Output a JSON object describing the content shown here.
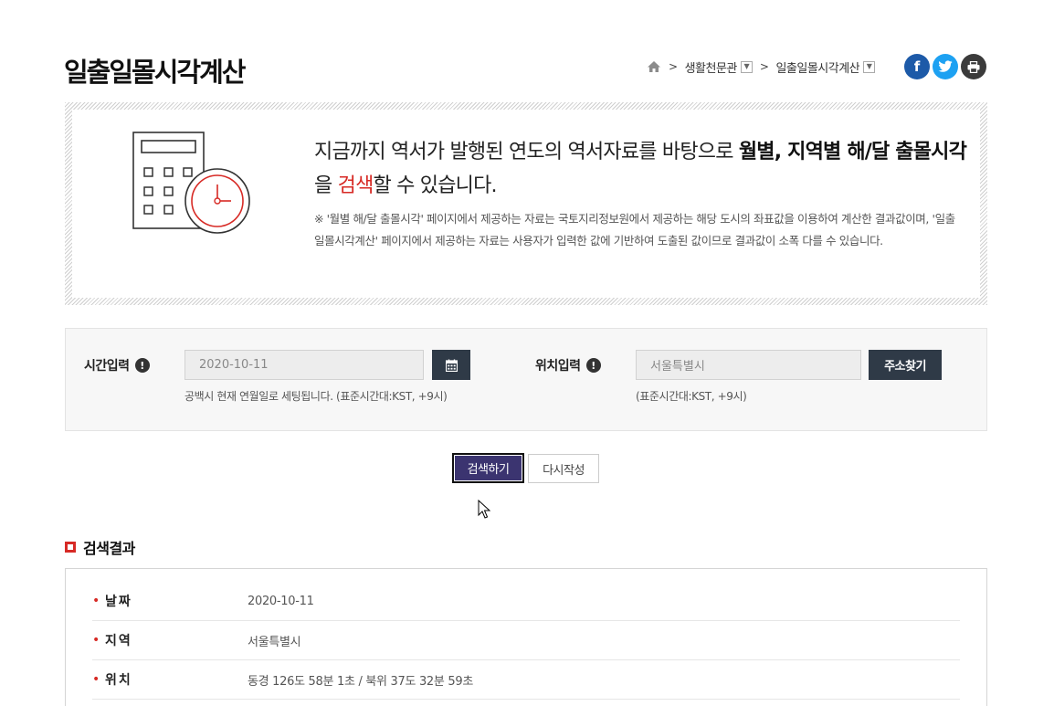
{
  "page": {
    "title": "일출일몰시각계산"
  },
  "breadcrumb": {
    "items": [
      {
        "label": "생활천문관"
      },
      {
        "label": "일출일몰시각계산"
      }
    ]
  },
  "social": {
    "facebook_glyph": "f",
    "twitter_glyph": "t"
  },
  "intro": {
    "lead_1": "지금까지 역서가 발행된 연도의 역서자료를 바탕으로 ",
    "lead_bold_1": "월별, 지역별 해/달 출몰시각",
    "lead_2": "을 ",
    "lead_red": "검색",
    "lead_3": "할 수 있습니다.",
    "note": "※ '월별 해/달 출몰시각' 페이지에서 제공하는 자료는 국토지리정보원에서 제공하는 해당 도시의 좌표값을 이용하여 계산한 결과값이며, '일출일몰시각계산' 페이지에서 제공하는 자료는 사용자가 입력한 값에 기반하여 도출된 값이므로 결과값이 소폭 다를 수 있습니다."
  },
  "form": {
    "time_label": "시간입력",
    "time_value": "2020-10-11",
    "time_hint": "공백시 현재 연월일로 세팅됩니다. (표준시간대:KST, +9시)",
    "location_label": "위치입력",
    "location_value": "서울특별시",
    "location_hint": "(표준시간대:KST, +9시)",
    "address_button": "주소찾기",
    "info_glyph": "!"
  },
  "actions": {
    "search": "검색하기",
    "reset": "다시작성"
  },
  "result": {
    "title": "검색결과",
    "bullet": "•",
    "rows": [
      {
        "label": "날짜",
        "value": "2020-10-11"
      },
      {
        "label": "지역",
        "value": "서울특별시"
      },
      {
        "label": "위치",
        "value": "동경 126도 58분 1초 / 북위 37도 32분 59초"
      }
    ]
  },
  "colors": {
    "accent_red": "#d72a25",
    "dark_button": "#2f3a47",
    "search_button": "#3b3470"
  },
  "icons": [
    "home-icon",
    "chevron-right-icon",
    "dropdown-icon",
    "facebook-icon",
    "twitter-icon",
    "print-icon",
    "calculator-clock-icon",
    "calendar-icon",
    "info-icon",
    "mouse-cursor-icon"
  ]
}
